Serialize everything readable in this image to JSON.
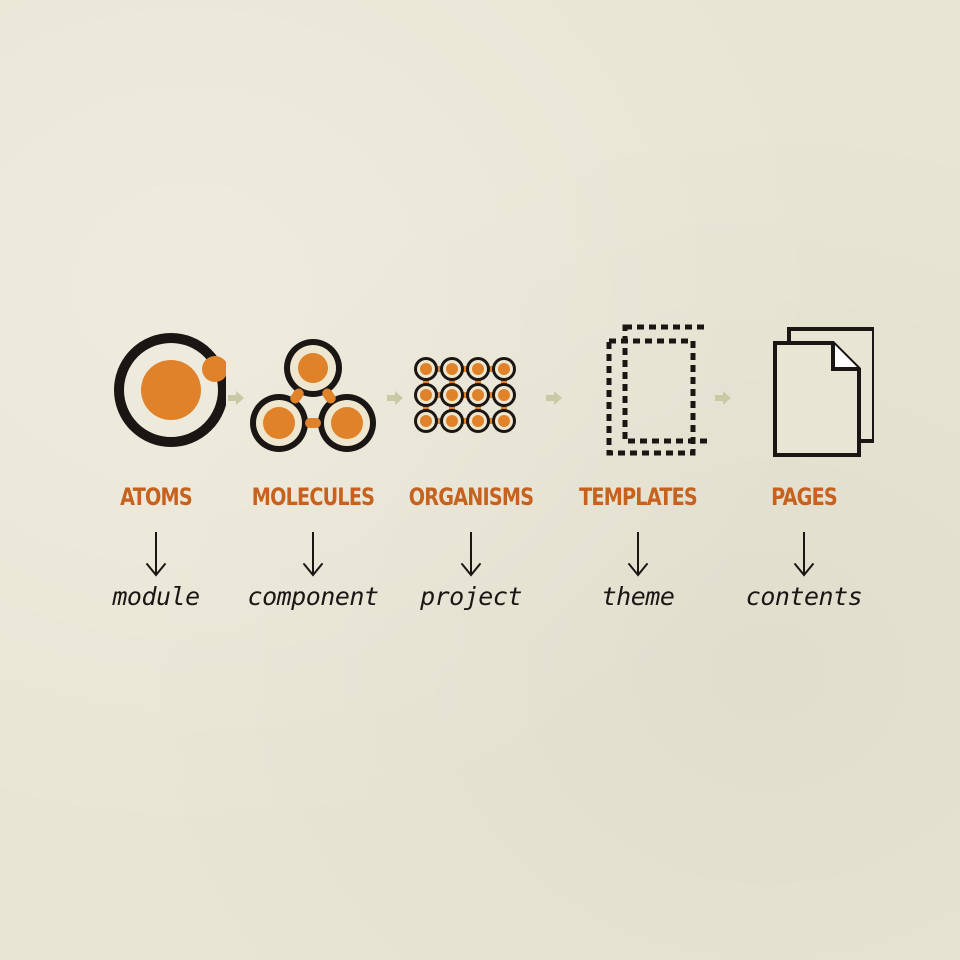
{
  "colors": {
    "background": "#e9e5d4",
    "accent": "#c6621e",
    "orange_fill": "#e0822a",
    "dark": "#1a1614",
    "flow_arrow": "#c9c9a5"
  },
  "stages": [
    {
      "title": "ATOMS",
      "label": "module",
      "icon": "atom-icon"
    },
    {
      "title": "MOLECULES",
      "label": "component",
      "icon": "molecule-icon"
    },
    {
      "title": "ORGANISMS",
      "label": "project",
      "icon": "organism-icon"
    },
    {
      "title": "TEMPLATES",
      "label": "theme",
      "icon": "template-icon"
    },
    {
      "title": "PAGES",
      "label": "contents",
      "icon": "pages-icon"
    }
  ]
}
